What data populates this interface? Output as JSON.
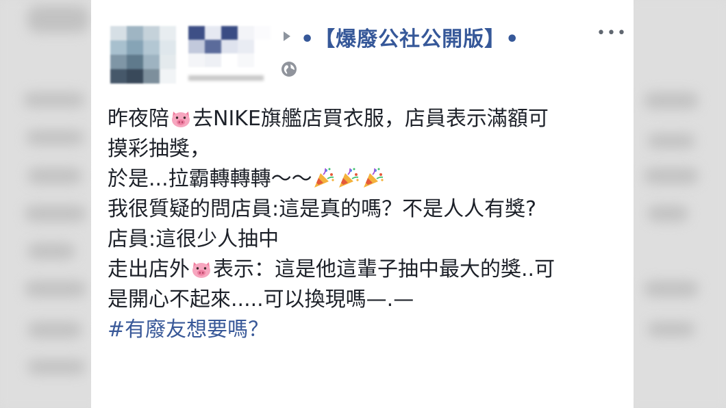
{
  "post": {
    "group_name": "•【爆廢公社公開版】•",
    "lines": [
      {
        "parts": [
          "昨夜陪",
          "去NIKE旗艦店買衣服，店員表示滿額可"
        ]
      },
      {
        "parts": [
          "摸彩抽獎，"
        ]
      },
      {
        "parts": [
          "於是...拉霸轉轉轉～～"
        ]
      },
      {
        "parts": [
          "我很質疑的問店員:這是真的嗎？不是人人有獎?"
        ]
      },
      {
        "parts": [
          "店員:這很少人抽中"
        ]
      },
      {
        "parts": [
          "走出店外",
          "表示：這是他這輩子抽中最大的獎..可"
        ]
      },
      {
        "parts": [
          "是開心不起來.....可以換現嗎—.—"
        ]
      }
    ],
    "hashtag": "#有廢友想要嗎？"
  },
  "icons": {
    "pig": "pig-face-emoji",
    "party": "party-popper-emoji",
    "globe": "globe-icon",
    "more": "more-options-icon",
    "arrow": "right-triangle-icon"
  },
  "colors": {
    "group_link": "#365899",
    "text": "#1d2129",
    "hashtag": "#385898"
  }
}
